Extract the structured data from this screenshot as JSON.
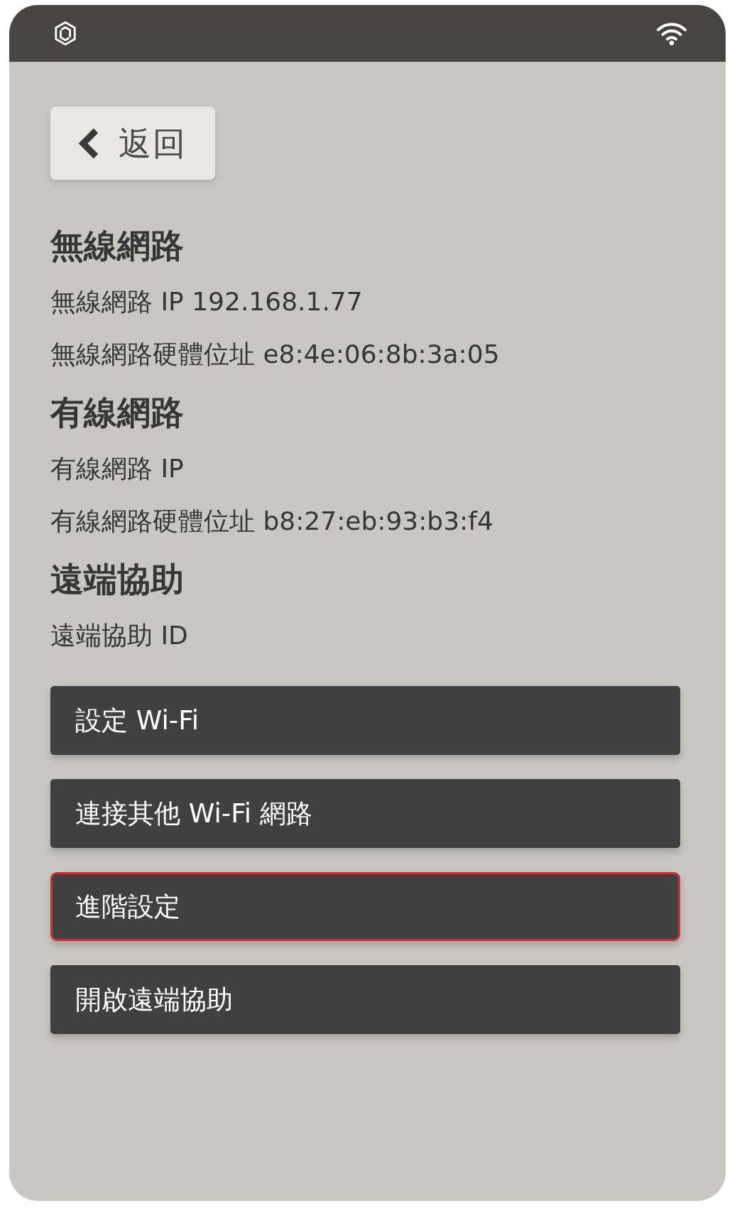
{
  "back_button": {
    "label": "返回"
  },
  "sections": [
    {
      "heading": "無線網路",
      "lines": [
        "無線網路 IP 192.168.1.77",
        "無線網路硬體位址 e8:4e:06:8b:3a:05"
      ]
    },
    {
      "heading": "有線網路",
      "lines": [
        "有線網路 IP",
        "有線網路硬體位址 b8:27:eb:93:b3:f4"
      ]
    },
    {
      "heading": "遠端協助",
      "lines": [
        "遠端協助 ID"
      ]
    }
  ],
  "buttons": [
    {
      "label": "設定 Wi-Fi",
      "focused": false
    },
    {
      "label": "連接其他 Wi-Fi 網路",
      "focused": false
    },
    {
      "label": "進階設定",
      "focused": true
    },
    {
      "label": "開啟遠端協助",
      "focused": false
    }
  ]
}
